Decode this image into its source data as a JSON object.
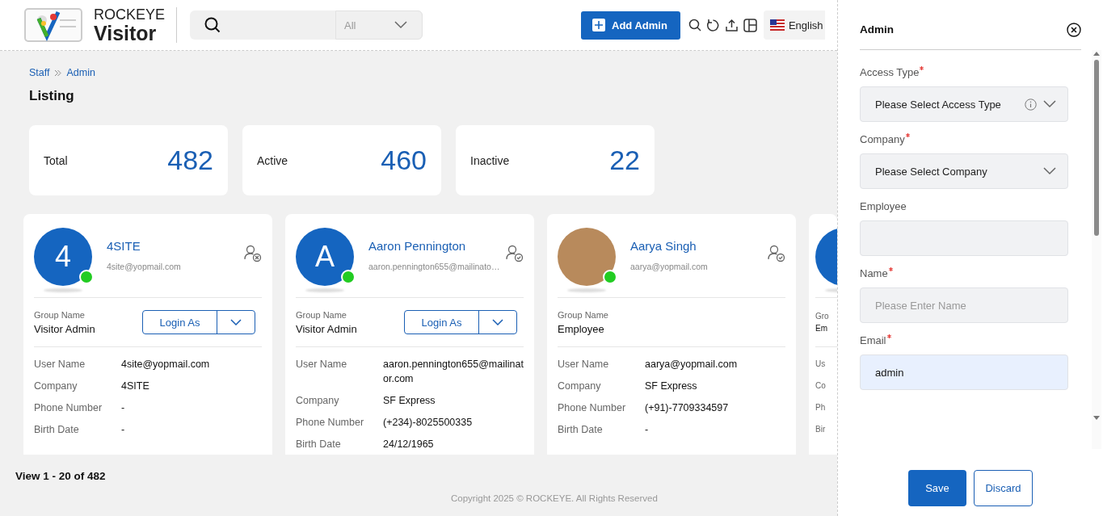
{
  "header": {
    "logo": {
      "brand": "ROCKEYE",
      "product": "Visitor"
    },
    "search_filter": {
      "value": "All"
    },
    "add_button": "Add Admin",
    "language": "English"
  },
  "breadcrumb": [
    {
      "label": "Staff"
    },
    {
      "label": "Admin"
    }
  ],
  "page_title": "Listing",
  "stats": [
    {
      "label": "Total",
      "value": "482"
    },
    {
      "label": "Active",
      "value": "460"
    },
    {
      "label": "Inactive",
      "value": "22"
    }
  ],
  "cards": [
    {
      "kind": "full",
      "avatar": {
        "kind": "letter",
        "letter": "4"
      },
      "online": true,
      "name": "4SITE",
      "email": "4site@yopmail.com",
      "verified": false,
      "group_label": "Group Name",
      "group": "Visitor Admin",
      "login_button": "Login As",
      "details": [
        {
          "label": "User Name",
          "value": "4site@yopmail.com"
        },
        {
          "label": "Company",
          "value": "4SITE"
        },
        {
          "label": "Phone Number",
          "value": "-"
        },
        {
          "label": "Birth Date",
          "value": "-"
        }
      ]
    },
    {
      "kind": "full",
      "avatar": {
        "kind": "letter",
        "letter": "A"
      },
      "online": true,
      "name": "Aaron Pennington",
      "email": "aaron.pennington655@mailinato…",
      "verified": true,
      "group_label": "Group Name",
      "group": "Visitor Admin",
      "login_button": "Login As",
      "details": [
        {
          "label": "User Name",
          "value": "aaron.pennington655@mailinator.com"
        },
        {
          "label": "Company",
          "value": "SF Express"
        },
        {
          "label": "Phone Number",
          "value": "(+234)-8025500335"
        },
        {
          "label": "Birth Date",
          "value": "24/12/1965"
        }
      ]
    },
    {
      "kind": "full",
      "avatar": {
        "kind": "photo"
      },
      "online": true,
      "name": "Aarya Singh",
      "email": "aarya@yopmail.com",
      "verified": true,
      "group_label": "Group Name",
      "group": "Employee",
      "details": [
        {
          "label": "User Name",
          "value": "aarya@yopmail.com"
        },
        {
          "label": "Company",
          "value": "SF Express"
        },
        {
          "label": "Phone Number",
          "value": "(+91)-7709334597"
        },
        {
          "label": "Birth Date",
          "value": "-"
        }
      ]
    },
    {
      "kind": "partial",
      "avatar": {
        "kind": "blank"
      },
      "group_label": "Gro",
      "group": "Em",
      "details": [
        {
          "label": "Us"
        },
        {
          "label": "Co"
        },
        {
          "label": "Ph"
        },
        {
          "label": "Bir"
        }
      ]
    }
  ],
  "pager": "View 1 - 20 of 482",
  "footer": "Copyright 2025 © ROCKEYE. All Rights Reserved",
  "drawer": {
    "title": "Admin",
    "fields": [
      {
        "kind": "select",
        "label": "Access Type",
        "required": true,
        "placeholder": "Please Select Access Type",
        "info": true
      },
      {
        "kind": "select",
        "label": "Company",
        "required": true,
        "placeholder": "Please Select Company"
      },
      {
        "kind": "input",
        "label": "Employee",
        "required": false
      },
      {
        "kind": "input",
        "label": "Name",
        "required": true,
        "placeholder": "Please Enter Name"
      },
      {
        "kind": "input",
        "label": "Email",
        "required": true,
        "value": "admin",
        "autofilled": true
      }
    ],
    "buttons": [
      {
        "kind": "primary",
        "label": "Save"
      },
      {
        "kind": "secondary",
        "label": "Discard"
      }
    ]
  }
}
